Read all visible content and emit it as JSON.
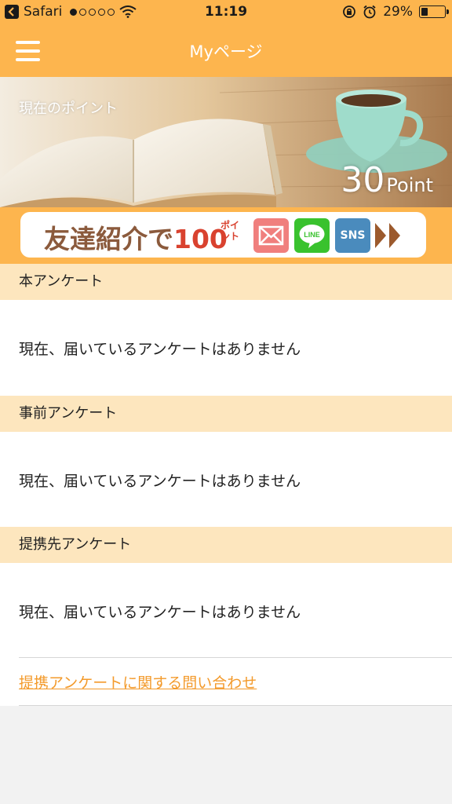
{
  "status_bar": {
    "carrier": "Safari",
    "signal_bars_filled": 1,
    "signal_bars_total": 5,
    "time": "11:19",
    "battery_percent": "29%",
    "battery_level": 0.29
  },
  "nav": {
    "title": "Myページ",
    "menu_icon": "hamburger-menu-icon"
  },
  "hero": {
    "label": "現在のポイント",
    "points_value": "30",
    "points_unit": "Point"
  },
  "banner": {
    "text_part1": "友達紹介で",
    "text_amount": "100",
    "text_small": "ポイント",
    "sns_label": "SNS",
    "line_label": "LINE"
  },
  "sections": [
    {
      "header": "本アンケート",
      "message": "現在、届いているアンケートはありません"
    },
    {
      "header": "事前アンケート",
      "message": "現在、届いているアンケートはありません"
    },
    {
      "header": "提携先アンケート",
      "message": "現在、届いているアンケートはありません"
    }
  ],
  "contact_link": "提携アンケートに関する問い合わせ",
  "colors": {
    "accent": "#fdb54e",
    "section_header_bg": "#fde6be",
    "link": "#f39a2b"
  }
}
